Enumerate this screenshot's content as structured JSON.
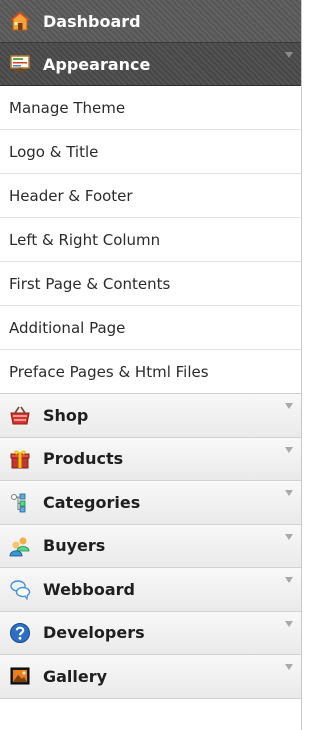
{
  "menu": {
    "dashboard": {
      "label": "Dashboard",
      "icon": "home-icon"
    },
    "appearance": {
      "label": "Appearance",
      "icon": "presentation-board-icon",
      "subitems": [
        "Manage Theme",
        "Logo & Title",
        "Header & Footer",
        "Left & Right Column",
        "First Page & Contents",
        "Additional Page",
        "Preface Pages & Html Files"
      ]
    },
    "sections": [
      {
        "label": "Shop",
        "icon": "shop-icon"
      },
      {
        "label": "Products",
        "icon": "gift-icon"
      },
      {
        "label": "Categories",
        "icon": "categories-icon"
      },
      {
        "label": "Buyers",
        "icon": "users-icon"
      },
      {
        "label": "Webboard",
        "icon": "chat-bubbles-icon"
      },
      {
        "label": "Developers",
        "icon": "help-icon"
      },
      {
        "label": "Gallery",
        "icon": "picture-icon"
      }
    ]
  },
  "colors": {
    "header_dark": "#5b5b5b",
    "section_bg": "#eeeeee",
    "text_dark": "#1f1f1f"
  }
}
